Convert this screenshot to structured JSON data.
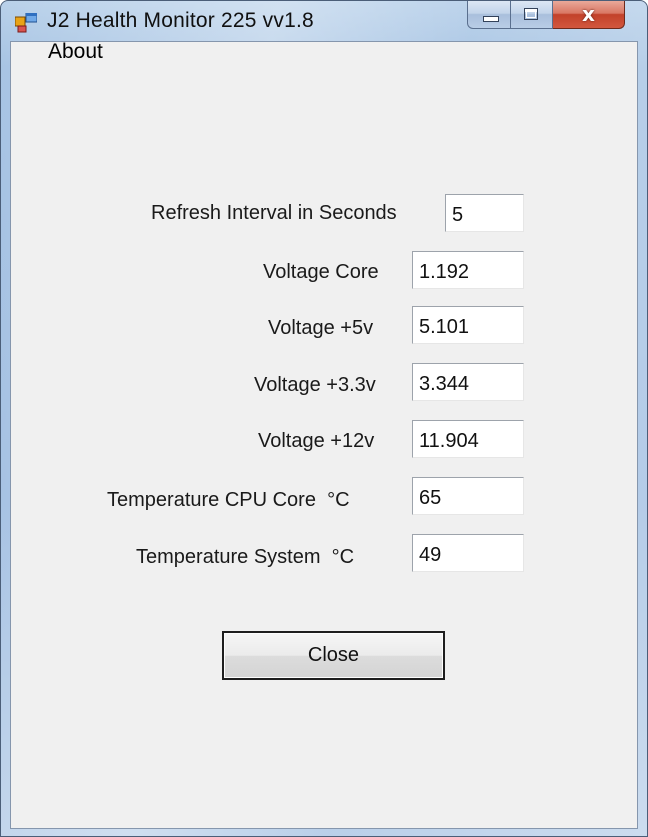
{
  "window": {
    "title": "J2 Health Monitor 225 vv1.8",
    "icon": "app-window-icon",
    "caption_buttons": {
      "minimize_icon": "minimize-icon",
      "maximize_icon": "maximize-icon",
      "close_symbol": "x"
    }
  },
  "menu": {
    "about": "About"
  },
  "form": {
    "refresh_interval": {
      "label": "Refresh Interval in Seconds",
      "value": "5"
    },
    "voltage_core": {
      "label": "Voltage Core",
      "value": "1.192"
    },
    "voltage_5v": {
      "label": "Voltage +5v",
      "value": "5.101"
    },
    "voltage_3_3v": {
      "label": "Voltage +3.3v",
      "value": "3.344"
    },
    "voltage_12v": {
      "label": "Voltage +12v",
      "value": "11.904"
    },
    "temp_cpu": {
      "label": "Temperature CPU Core  °C",
      "value": "65"
    },
    "temp_system": {
      "label": "Temperature System  °C",
      "value": "49"
    }
  },
  "buttons": {
    "close": "Close"
  },
  "colors": {
    "client_background": "#f0f0f0",
    "window_frame": "#a6c3e3",
    "close_caption": "#c2412a"
  }
}
